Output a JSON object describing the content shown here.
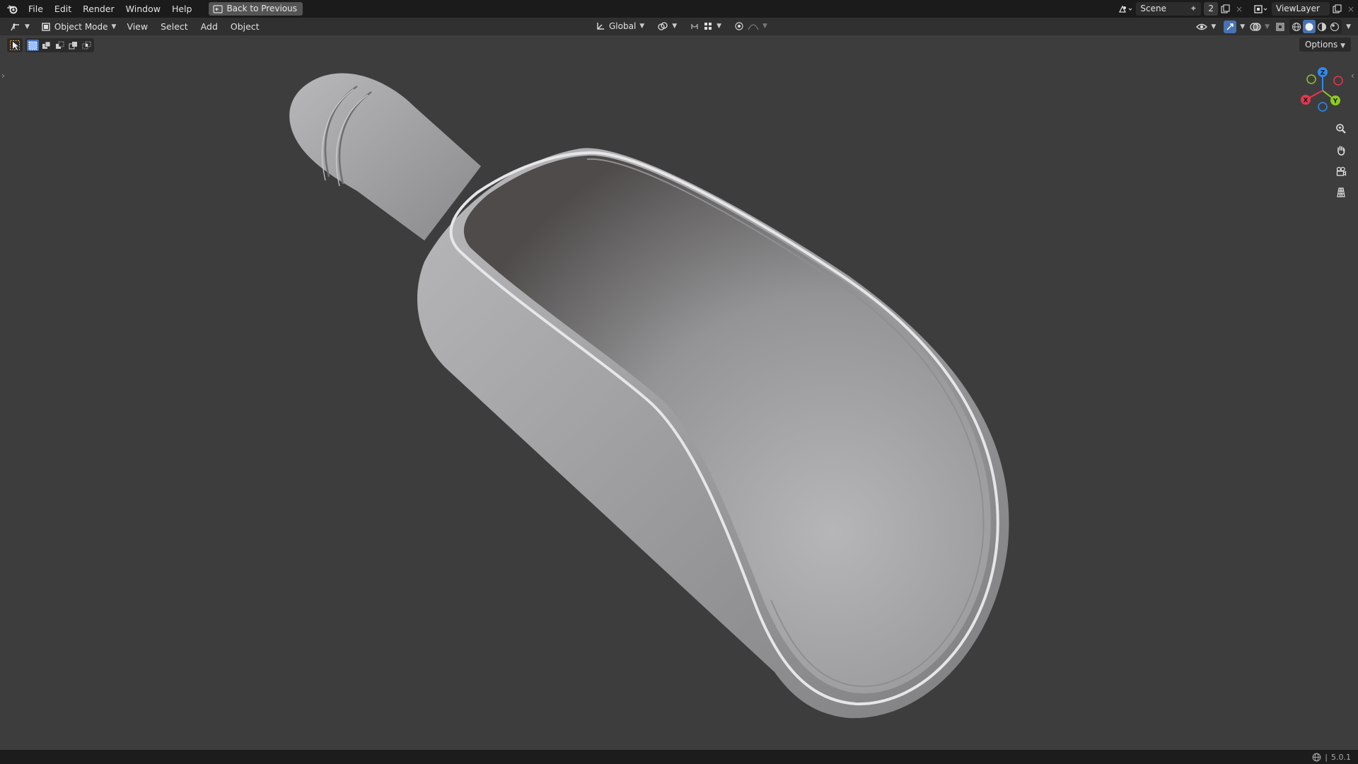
{
  "topbar": {
    "menus": [
      "File",
      "Edit",
      "Render",
      "Window",
      "Help"
    ],
    "back_button": "Back to Previous",
    "scene_name": "Scene",
    "scene_users": "2",
    "view_layer": "ViewLayer"
  },
  "header": {
    "mode": "Object Mode",
    "menus": [
      "View",
      "Select",
      "Add",
      "Object"
    ],
    "orientation": "Global"
  },
  "viewport": {
    "options_label": "Options",
    "gizmo_axes": [
      "Z",
      "Y",
      "X"
    ]
  },
  "statusbar": {
    "version": "5.0.1"
  },
  "colors": {
    "accent": "#4772b3",
    "axis_x": "#e8364f",
    "axis_y": "#8ccb1e",
    "axis_z": "#2c8bf2",
    "viewport_bg": "#3d3d3d"
  },
  "icons": [
    "blender-logo-icon",
    "editor-type-icon",
    "transform-orientation-icon",
    "pivot-icon",
    "snap-icon",
    "proportional-edit-icon",
    "visibility-icon",
    "gizmo-icon",
    "overlay-icon",
    "xray-icon",
    "wireframe-shading-icon",
    "solid-shading-icon",
    "material-shading-icon",
    "rendered-shading-icon",
    "zoom-icon",
    "pan-icon",
    "camera-icon",
    "grid-icon"
  ]
}
